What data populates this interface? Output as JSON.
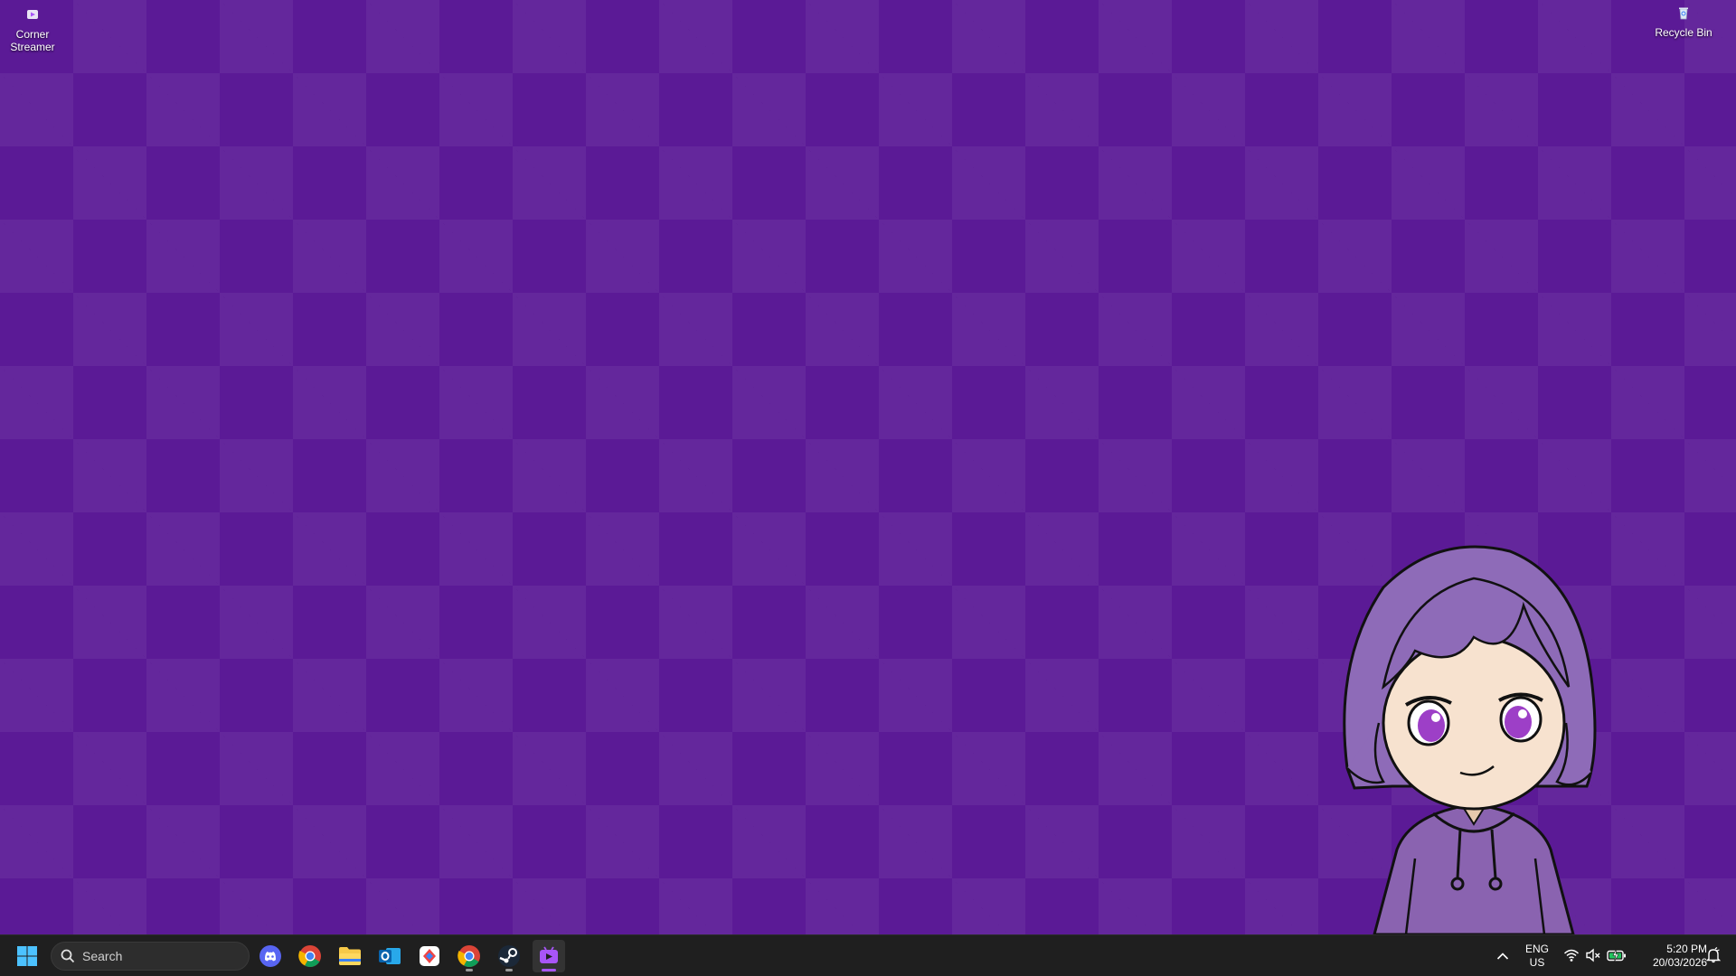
{
  "desktop": {
    "icons": [
      {
        "label": "Corner Streamer",
        "icon": "corner-streamer-icon"
      },
      {
        "label": "Recycle Bin",
        "icon": "recycle-bin-icon"
      }
    ],
    "wallpaper_color": "#5b1a96"
  },
  "taskbar": {
    "search_placeholder": "Search",
    "apps": [
      "start-icon",
      "discord-icon",
      "chrome-icon",
      "file-explorer-icon",
      "outlook-icon",
      "app-icon",
      "chrome-alt-icon",
      "steam-icon",
      "corner-streamer-icon"
    ],
    "tray": {
      "lang_top": "ENG",
      "lang_bottom": "US",
      "time": "5:20 PM",
      "date": "20/03/2026"
    },
    "accent": "#a855f7"
  }
}
